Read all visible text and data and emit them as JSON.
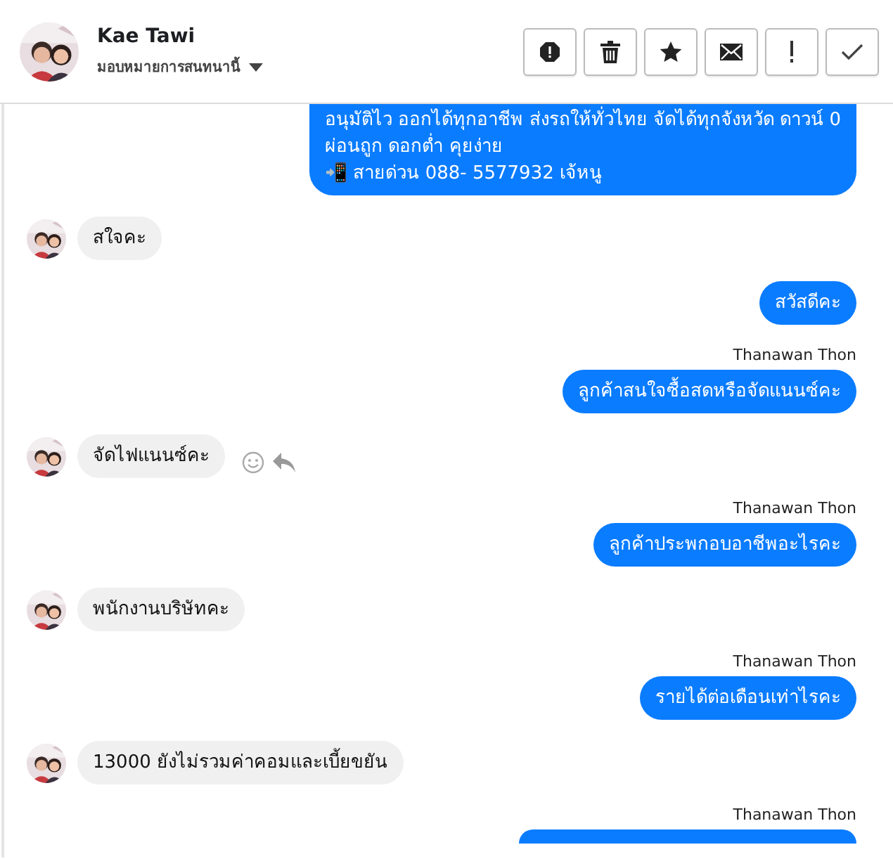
{
  "header": {
    "name": "Kae Tawi",
    "assign_label": "มอบหมายการสนทนานี้",
    "actions": [
      {
        "kind": "alert"
      },
      {
        "kind": "trash"
      },
      {
        "kind": "star"
      },
      {
        "kind": "mail"
      },
      {
        "kind": "exclaim"
      },
      {
        "kind": "check"
      }
    ]
  },
  "messages": [
    {
      "kind": "outgoing",
      "lines": [
        "อนุมัติไว ออกได้ทุกอาชีพ ส่งรถให้ทั่วไทย จัดได้ทุกจังหวัด ดาวน์ 0",
        "ผ่อนถูก ดอกต่ำ คุยง่าย",
        "📲 สายด่วน 088- 5577932 เจ้หนู"
      ],
      "cut": true
    },
    {
      "kind": "incoming",
      "text": "สใจคะ",
      "show_actions": false
    },
    {
      "kind": "outgoing",
      "text": "สวัสดีคะ"
    },
    {
      "kind": "outgoing",
      "sender": "Thanawan Thon",
      "text": "ลูกค้าสนใจซื้อสดหรือจัดแนนซ์คะ"
    },
    {
      "kind": "incoming",
      "text": "จัดไฟแนนซ์คะ",
      "show_actions": true
    },
    {
      "kind": "outgoing",
      "sender": "Thanawan Thon",
      "text": "ลูกค้าประพกอบอาชีพอะไรคะ"
    },
    {
      "kind": "incoming",
      "text": "พนักงานบริษัทคะ",
      "show_actions": false
    },
    {
      "kind": "outgoing",
      "sender": "Thanawan Thon",
      "text": "รายได้ต่อเดือนเท่าไรคะ"
    },
    {
      "kind": "incoming",
      "text": "13000 ยังไม่รวมค่าคอมและเบี้ยขยัน",
      "show_actions": false
    },
    {
      "kind": "outgoing",
      "sender": "Thanawan Thon",
      "cut_bottom": true
    }
  ]
}
